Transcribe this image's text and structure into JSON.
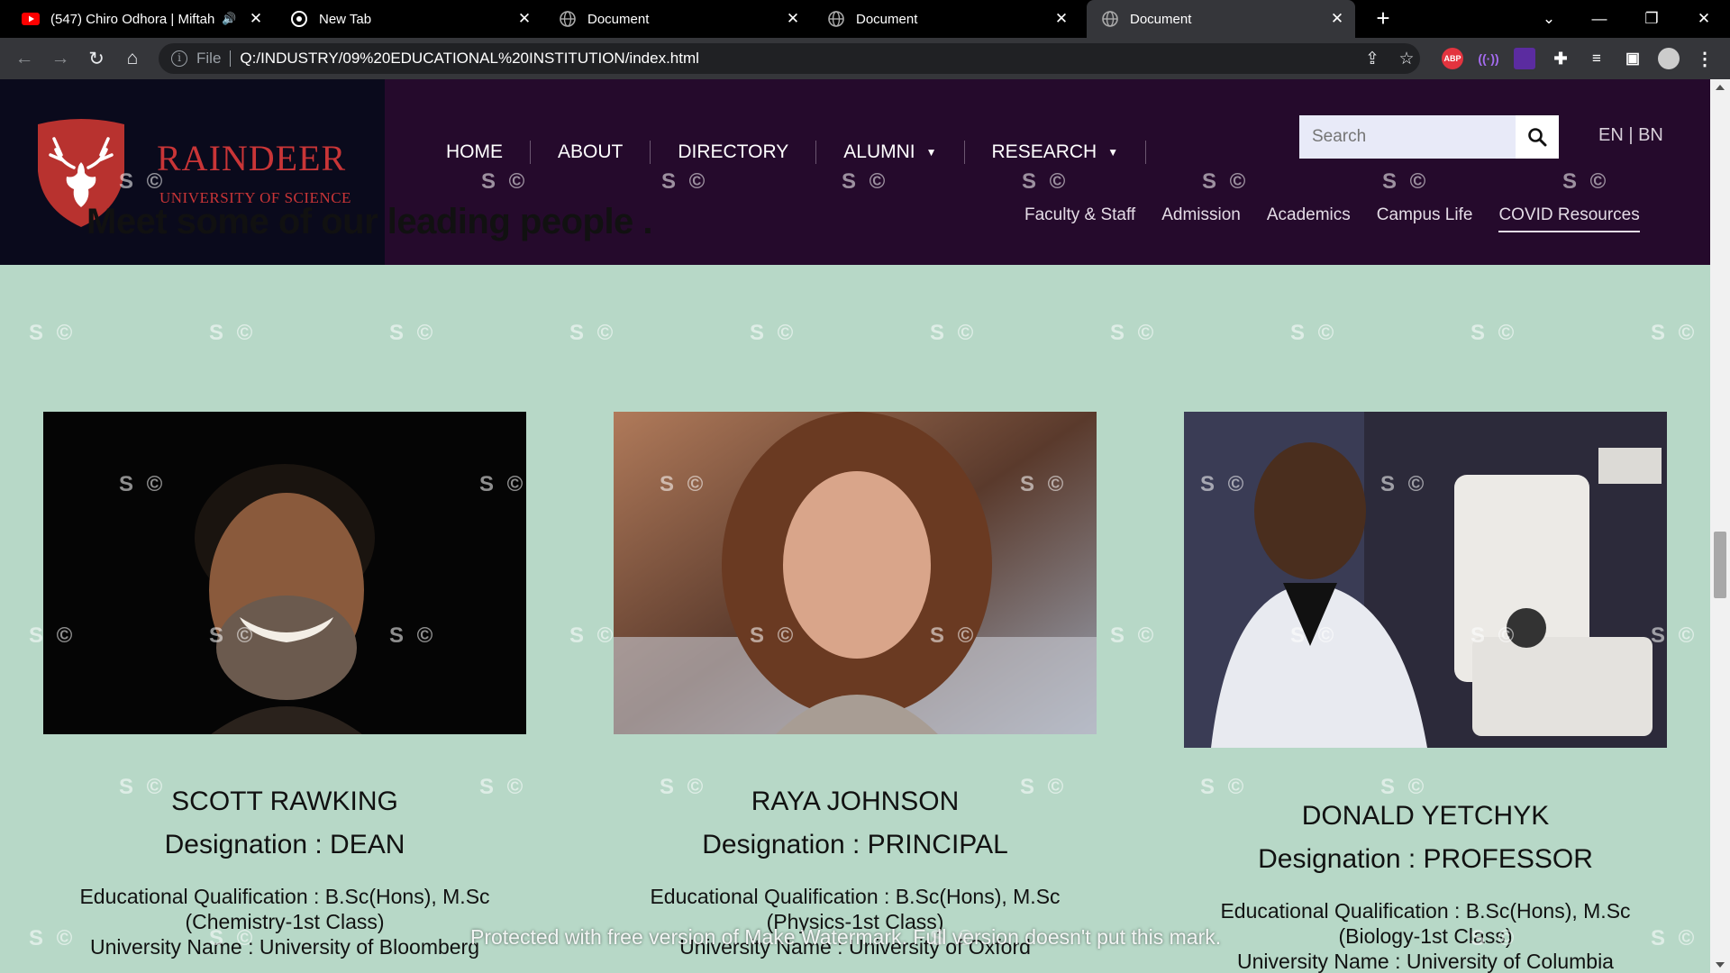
{
  "browser": {
    "tabs": [
      {
        "title": "(547) Chiro Odhora | Miftah",
        "icon": "youtube-icon",
        "audio": "🔊",
        "active": false
      },
      {
        "title": "New Tab",
        "icon": "chrome-icon",
        "active": false
      },
      {
        "title": "Document",
        "icon": "globe-icon",
        "active": false
      },
      {
        "title": "Document",
        "icon": "globe-icon",
        "active": false
      },
      {
        "title": "Document",
        "icon": "globe-icon",
        "active": true
      }
    ],
    "scheme": "File",
    "url": "Q:/INDUSTRY/09%20EDUCATIONAL%20INSTITUTION/index.html",
    "extensions": {
      "abp": "ABP"
    }
  },
  "site": {
    "brand": "RAINDEER",
    "brand_sub": "UNIVERSITY OF SCIENCE",
    "nav": [
      {
        "label": "HOME",
        "caret": ""
      },
      {
        "label": "ABOUT",
        "caret": ""
      },
      {
        "label": "DIRECTORY",
        "caret": ""
      },
      {
        "label": "ALUMNI",
        "caret": "▼"
      },
      {
        "label": "RESEARCH",
        "caret": "▼"
      }
    ],
    "search_placeholder": "Search",
    "lang": "EN | BN",
    "subnav": [
      "Faculty & Staff",
      "Admission",
      "Academics",
      "Campus Life",
      "COVID Resources"
    ],
    "accent": "#c93537",
    "header_bg": "#250a2c",
    "page_bg": "#b7d8c7"
  },
  "section": {
    "heading": "Meet some of our leading people ."
  },
  "people": [
    {
      "name": "SCOTT RAWKING",
      "designation": "Designation : DEAN",
      "edu_line1": "Educational Qualification : B.Sc(Hons), M.Sc",
      "edu_line2": "(Chemistry-1st Class)",
      "university": "University Name : University of Bloomberg"
    },
    {
      "name": "RAYA JOHNSON",
      "designation": "Designation : PRINCIPAL",
      "edu_line1": "Educational Qualification : B.Sc(Hons), M.Sc",
      "edu_line2": "(Physics-1st Class)",
      "university": "University Name : University of Oxford"
    },
    {
      "name": "DONALD YETCHYK",
      "designation": "Designation : PROFESSOR",
      "edu_line1": "Educational Qualification : B.Sc(Hons), M.Sc",
      "edu_line2": "(Biology-1st Class)",
      "university": "University Name : University of Columbia"
    }
  ],
  "watermark": {
    "mark": "S ©",
    "notice": "Protected with free version of Make Watermark. Full version doesn't put this mark."
  }
}
